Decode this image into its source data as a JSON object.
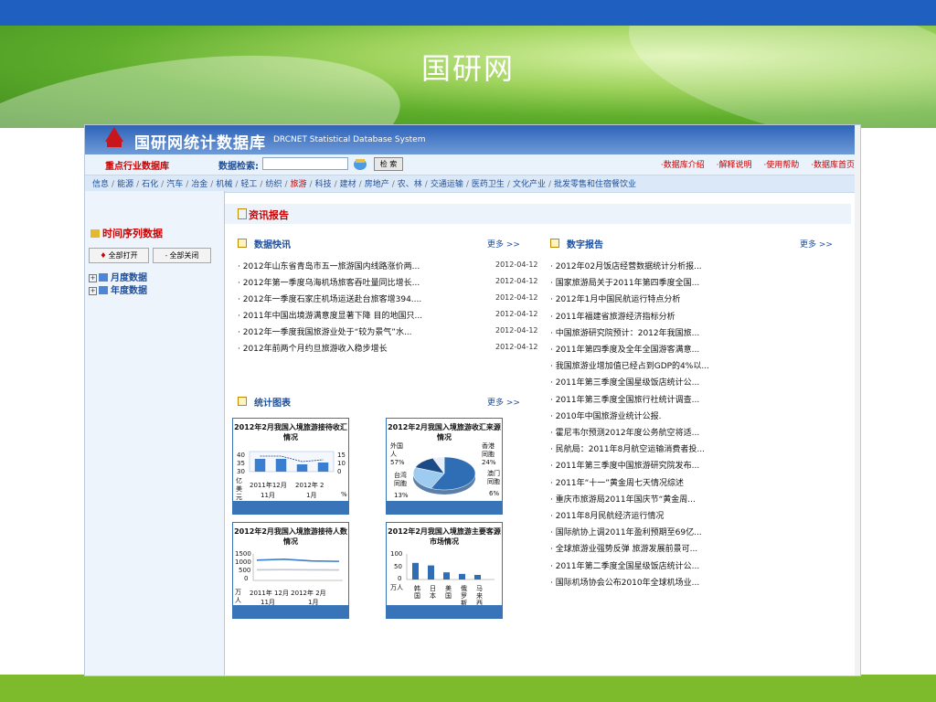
{
  "slide": {
    "title": "国研网"
  },
  "app": {
    "name": "国研网统计数据库",
    "subtitle": "DRCNET Statistical Database System"
  },
  "search": {
    "industry_label": "重点行业数据库",
    "label": "数据检索:",
    "placeholder": "",
    "button": "检 索"
  },
  "top_links": [
    "·数据库介绍",
    "·解释说明",
    "·使用帮助",
    "·数据库首页"
  ],
  "categories": [
    "信息",
    "能源",
    "石化",
    "汽车",
    "冶金",
    "机械",
    "轻工",
    "纺织",
    "旅游",
    "科技",
    "建材",
    "房地产",
    "农、林",
    "交通运输",
    "医药卫生",
    "文化产业",
    "批发零售和住宿餐饮业"
  ],
  "active_category": "旅游",
  "sidebar": {
    "title": "时间序列数据",
    "expand_all": "全部打开",
    "collapse_all": "全部关闭",
    "tree": [
      "月度数据",
      "年度数据"
    ]
  },
  "info_title": "资讯报告",
  "news": {
    "title": "数据快讯",
    "more": "更多 >>",
    "items": [
      {
        "text": "· 2012年山东省青岛市五一旅游国内线路涨价两...",
        "date": "2012-04-12"
      },
      {
        "text": "· 2012年第一季度乌海机场旅客吞吐量同比增长...",
        "date": "2012-04-12"
      },
      {
        "text": "· 2012年一季度石家庄机场运送赴台旅客增394....",
        "date": "2012-04-12"
      },
      {
        "text": "· 2011年中国出境游满意度显著下降 目的地国只...",
        "date": "2012-04-12"
      },
      {
        "text": "· 2012年一季度我国旅游业处于“较为景气”水...",
        "date": "2012-04-12"
      },
      {
        "text": "· 2012年前两个月约旦旅游收入稳步增长",
        "date": "2012-04-12"
      }
    ]
  },
  "reports": {
    "title": "数字报告",
    "more": "更多 >>",
    "items": [
      "· 2012年02月饭店经营数据统计分析报...",
      "· 国家旅游局关于2011年第四季度全国...",
      "· 2012年1月中国民航运行特点分析",
      "· 2011年福建省旅游经济指标分析",
      "· 中国旅游研究院预计：2012年我国旅...",
      "· 2011年第四季度及全年全国游客满意...",
      "· 我国旅游业增加值已经占到GDP的4%以...",
      "· 2011年第三季度全国星级饭店统计公...",
      "· 2011年第三季度全国旅行社统计调查...",
      "· 2010年中国旅游业统计公报.",
      "· 霍尼韦尔预测2012年度公务航空将适...",
      "· 民航局：2011年8月航空运输消费者投...",
      "· 2011年第三季度中国旅游研究院发布...",
      "· 2011年“十一”黄金周七天情况综述",
      "· 重庆市旅游局2011年国庆节“黄金周...",
      "· 2011年8月民航经济运行情况",
      "· 国际航协上调2011年盈利预期至69亿...",
      "· 全球旅游业强势反弹 旅游发展前景可...",
      "· 2011年第二季度全国星级饭店统计公...",
      "· 国际机场协会公布2010年全球机场业..."
    ]
  },
  "charts": {
    "title": "统计图表",
    "more": "更多 >>",
    "c1": {
      "title": "2012年2月我国入境旅游接待收汇情况",
      "yleft": [
        "40",
        "35",
        "30"
      ],
      "yright": [
        "15",
        "10",
        "0"
      ],
      "unit_left": "亿美元",
      "unit_right": "%",
      "x": [
        "2011年12月",
        "2012年 2",
        "11月",
        "1月"
      ]
    },
    "c2": {
      "title": "2012年2月我国入境旅游收汇来源情况",
      "labels": {
        "foreign": "外国人",
        "foreign_pct": "57%",
        "hk": "香港同胞",
        "hk_pct": "24%",
        "mo": "澳门同胞",
        "mo_pct": "6%",
        "tw": "台湾同胞",
        "tw_pct": "13%"
      }
    },
    "c3": {
      "title": "2012年2月我国入境旅游接待人数情况",
      "y": [
        "1500",
        "1000",
        "500",
        "0"
      ],
      "unit": "万人次",
      "x": [
        "2011年 12月 2012年 2月",
        "11月",
        "1月"
      ]
    },
    "c4": {
      "title": "2012年2月我国入境旅游主要客源市场情况",
      "y": [
        "100",
        "50",
        "0"
      ],
      "unit": "万人",
      "x": [
        "韩国",
        "日本",
        "美国",
        "俄罗斯",
        "马来西亚"
      ]
    }
  },
  "chart_data": [
    {
      "type": "bar",
      "title": "2012年2月我国入境旅游接待收汇情况",
      "categories": [
        "2011年11月",
        "2011年12月",
        "2012年1月",
        "2012年2月"
      ],
      "values": [
        37,
        37,
        34,
        35
      ],
      "ylim": [
        30,
        40
      ]
    },
    {
      "type": "pie",
      "title": "2012年2月我国入境旅游收汇来源情况",
      "categories": [
        "外国人",
        "香港同胞",
        "台湾同胞",
        "澳门同胞"
      ],
      "values": [
        57,
        24,
        13,
        6
      ]
    },
    {
      "type": "line",
      "title": "2012年2月我国入境旅游接待人数情况",
      "series": [
        {
          "values": [
            1150,
            1200,
            1100,
            1080
          ]
        },
        {
          "values": [
            600,
            610,
            600,
            590
          ]
        }
      ],
      "ylim": [
        0,
        1500
      ]
    },
    {
      "type": "bar",
      "title": "2012年2月我国入境旅游主要客源市场情况",
      "categories": [
        "韩国",
        "日本",
        "美国",
        "俄罗斯",
        "马来西亚"
      ],
      "values": [
        65,
        55,
        28,
        22,
        18
      ],
      "ylim": [
        0,
        100
      ]
    }
  ],
  "colors": {
    "accent": "#3a74b8",
    "red": "#c00000",
    "header_top": "#1f5fbf"
  }
}
